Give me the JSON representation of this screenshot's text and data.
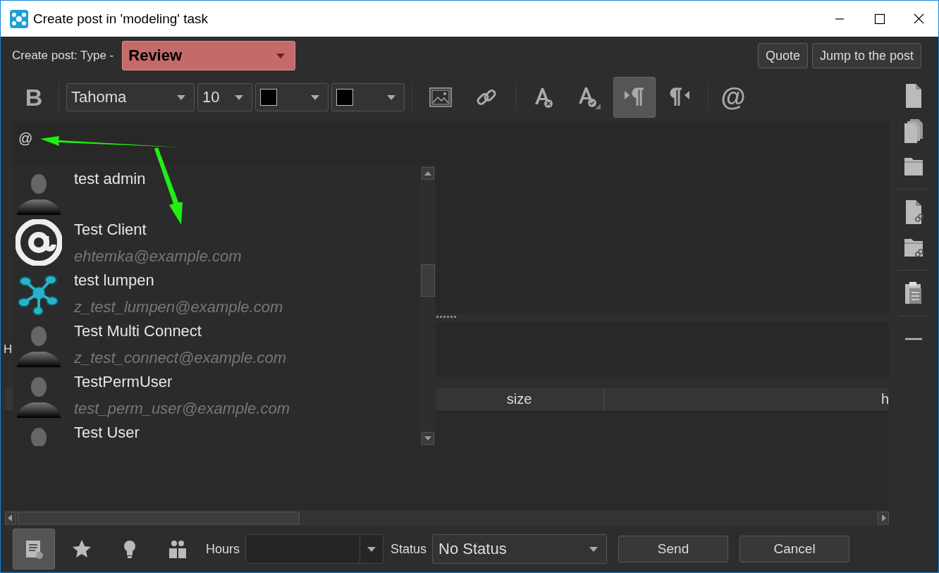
{
  "window": {
    "title": "Create post in 'modeling' task"
  },
  "header": {
    "type_label": "Create post: Type -",
    "type_value": "Review",
    "buttons": [
      "Quote",
      "Jump to the post"
    ]
  },
  "toolbar": {
    "bold_glyph": "B",
    "font": "Tahoma",
    "size": "10",
    "mention_glyph": "@",
    "directions": [
      {
        "kind": "ltr",
        "selected": true
      },
      {
        "kind": "rtl",
        "selected": false
      }
    ]
  },
  "editor": {
    "text": "@"
  },
  "mention_list": {
    "items": [
      {
        "kind": "person",
        "name": "test admin"
      },
      {
        "kind": "at",
        "name": "Test Client",
        "email": "ehtemka@example.com"
      },
      {
        "kind": "logo",
        "name": "test lumpen",
        "email": "z_test_lumpen@example.com"
      },
      {
        "kind": "person",
        "name": "Test Multi Connect",
        "email": "z_test_connect@example.com"
      },
      {
        "kind": "person",
        "name": "TestPermUser",
        "email": "test_perm_user@example.com"
      },
      {
        "kind": "person",
        "name": "Test User"
      }
    ]
  },
  "attachments": {
    "label": "H",
    "columns": [
      "size",
      "h"
    ]
  },
  "bottom": {
    "toggles": [
      {
        "kind": "post",
        "selected": true
      },
      {
        "kind": "star",
        "selected": false
      },
      {
        "kind": "bulb",
        "selected": false
      },
      {
        "kind": "people",
        "selected": false
      }
    ],
    "hours_label": "Hours",
    "status_label": "Status",
    "status_value": "No Status",
    "buttons": [
      "Send",
      "Cancel"
    ]
  }
}
